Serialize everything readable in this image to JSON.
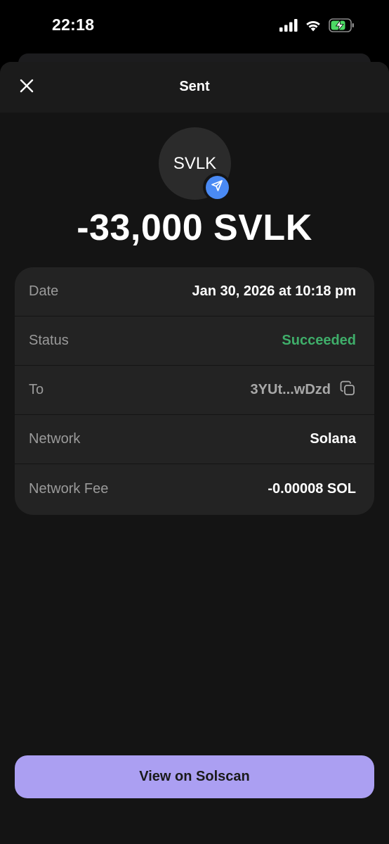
{
  "status_bar": {
    "time": "22:18",
    "icons": [
      "cellular-signal-icon",
      "wifi-icon",
      "battery-charging-icon"
    ]
  },
  "header": {
    "title": "Sent",
    "close_icon": "close-icon"
  },
  "token": {
    "symbol": "SVLK",
    "badge_icon": "send-arrow-icon",
    "badge_color": "#4a8af4"
  },
  "amount": "-33,000 SVLK",
  "details": {
    "date": {
      "label": "Date",
      "value": "Jan 30, 2026 at 10:18 pm"
    },
    "status": {
      "label": "Status",
      "value": "Succeeded",
      "color": "#3fae6a"
    },
    "to": {
      "label": "To",
      "value": "3YUt...wDzd",
      "icon": "copy-icon"
    },
    "network": {
      "label": "Network",
      "value": "Solana"
    },
    "fee": {
      "label": "Network Fee",
      "value": "-0.00008 SOL"
    }
  },
  "actions": {
    "view_button": "View on Solscan",
    "accent": "#ab9ff2"
  }
}
